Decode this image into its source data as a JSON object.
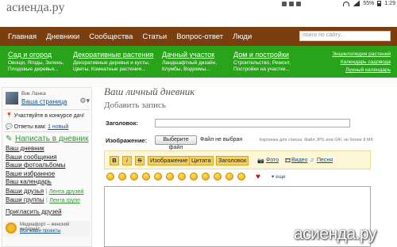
{
  "site": {
    "logo": "асиенда.ру"
  },
  "statusbar": {
    "battery": "55%",
    "time": "1:29"
  },
  "nav": {
    "items": [
      "Главная",
      "Дневники",
      "Сообщества",
      "Статьи",
      "Вопрос-ответ",
      "Люди"
    ],
    "search_placeholder": "поиск по сайту..."
  },
  "categories": [
    {
      "title": "Сад и огород",
      "sub1": "Овощи, Ягоды, Зелень,",
      "sub2": "Плодовые деревья..."
    },
    {
      "title": "Декоративные растения",
      "sub1": "Декоративные деревья и кусты,",
      "sub2": "Цветы, Комнатные растения..."
    },
    {
      "title": "Дачный участок",
      "sub1": "Ландшафтный дизайн,",
      "sub2": "Клумбы, Водоемы..."
    },
    {
      "title": "Дом и постройки",
      "sub1": "Строительство, Ремонт,",
      "sub2": "Постройки на участке..."
    }
  ],
  "green_links": [
    "Энциклопедия растений",
    "Календарь садовода",
    "Лунный календарь"
  ],
  "sidebar": {
    "user_name": "Вик Ланка",
    "user_page": "Ваша страница",
    "contest": "Участвуйте в конкурсе дач!",
    "answers_label": "Ответы вам:",
    "answers_link": "1 новый",
    "write_label": "Написать в дневник",
    "menu1": [
      "Ваш дневник",
      "Ваши сообщения",
      "Ваши фотоальбомы",
      "Ваше избранное",
      "Ваш календарь"
    ],
    "friends": "Ваши друзья",
    "friends_feed": "Лента друзей",
    "groups": "Ваши группы",
    "groups_feed": "Лента групп",
    "invite": "Пригласить друзей",
    "footer_title": "Медиафорт – женский интернет",
    "footer_link": "Все наши проекты"
  },
  "main": {
    "page_title": "Ваш личный дневник",
    "subtitle": "Добавить запись",
    "title_label": "Заголовок:",
    "image_label": "Изображение:",
    "file_button": "Выберите файл",
    "file_status": "Файл не выбран",
    "file_hint": "Картинка для списка. Файл JPG или GIF, не более 8 Мб"
  },
  "toolbar": {
    "bold": "B",
    "italic": "i",
    "strike": "S",
    "image": "Изображение",
    "quote": "Цитата",
    "heading": "Заголовок",
    "photo": "Фото",
    "video": "Видео",
    "song": "Песня"
  },
  "smiley_more": "еще",
  "watermark": "асиенда.ру"
}
